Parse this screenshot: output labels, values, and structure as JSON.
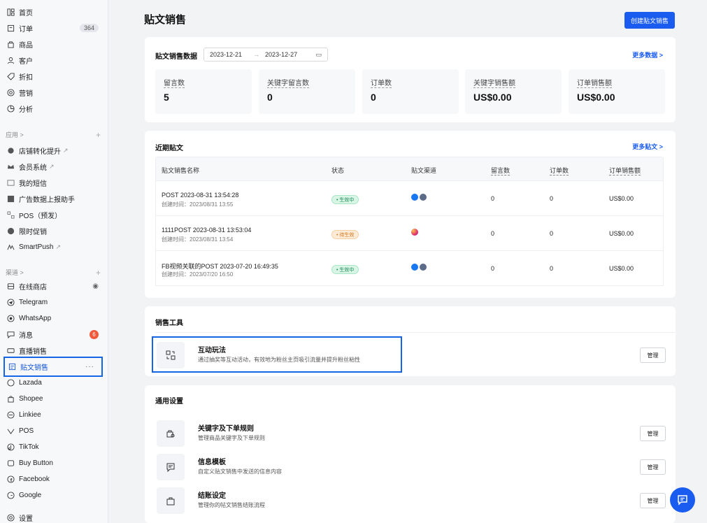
{
  "sidebar": {
    "main_items": [
      {
        "label": "首页"
      },
      {
        "label": "订单",
        "badge": "364"
      },
      {
        "label": "商品"
      },
      {
        "label": "客户"
      },
      {
        "label": "折扣"
      },
      {
        "label": "营销"
      },
      {
        "label": "分析"
      }
    ],
    "apps_section": "应用 >",
    "apps_items": [
      {
        "label": "店铺转化提升"
      },
      {
        "label": "会员系统"
      },
      {
        "label": "我的短信"
      },
      {
        "label": "广告数据上报助手"
      },
      {
        "label": "POS（预发）"
      },
      {
        "label": "限时促销"
      },
      {
        "label": "SmartPush"
      }
    ],
    "channels_section": "渠道 >",
    "channel_items": [
      {
        "label": "在线商店"
      },
      {
        "label": "Telegram"
      },
      {
        "label": "WhatsApp"
      },
      {
        "label": "消息",
        "badge": "6"
      },
      {
        "label": "直播销售"
      },
      {
        "label": "贴文销售"
      },
      {
        "label": "Lazada"
      },
      {
        "label": "Shopee"
      },
      {
        "label": "Linkiee"
      },
      {
        "label": "POS"
      },
      {
        "label": "TikTok"
      },
      {
        "label": "Buy Button"
      },
      {
        "label": "Facebook"
      },
      {
        "label": "Google"
      }
    ],
    "settings_label": "设置"
  },
  "header": {
    "title": "贴文销售",
    "create_button": "创建贴文销售"
  },
  "stats": {
    "title": "贴文销售数据",
    "date_start": "2023-12-21",
    "date_arrow": "→",
    "date_end": "2023-12-27",
    "more": "更多数据 >",
    "cards": [
      {
        "label": "留言数",
        "value": "5"
      },
      {
        "label": "关键字留言数",
        "value": "0"
      },
      {
        "label": "订单数",
        "value": "0"
      },
      {
        "label": "关键字销售额",
        "value": "US$0.00"
      },
      {
        "label": "订单销售额",
        "value": "US$0.00"
      }
    ]
  },
  "posts": {
    "title": "近期贴文",
    "more": "更多贴文 >",
    "columns": [
      "贴文销售名称",
      "状态",
      "贴文渠道",
      "留言数",
      "订单数",
      "订单销售额"
    ],
    "rows": [
      {
        "name": "POST 2023-08-31 13:54:28",
        "created": "创建时间：2023/08/31 13:55",
        "status": "• 生效中",
        "comments": "0",
        "orders": "0",
        "sales": "US$0.00"
      },
      {
        "name": "1111POST 2023-08-31 13:53:04",
        "created": "创建时间：2023/08/31 13:54",
        "status": "• 待生效",
        "comments": "0",
        "orders": "0",
        "sales": "US$0.00"
      },
      {
        "name": "FB视频关联的POST 2023-07-20 16:49:35",
        "created": "创建时间：2023/07/20 16:50",
        "status": "• 生效中",
        "comments": "0",
        "orders": "0",
        "sales": "US$0.00"
      }
    ]
  },
  "tools": {
    "title": "销售工具",
    "items": [
      {
        "name": "互动玩法",
        "desc": "通过抽奖等互动活动，有效地为粉丝主页吸引流量并提升粉丝粘性",
        "button": "管理"
      }
    ]
  },
  "general": {
    "title": "通用设置",
    "items": [
      {
        "name": "关键字及下单规则",
        "desc": "管理商品关键字及下单规则",
        "button": "管理"
      },
      {
        "name": "信息模板",
        "desc": "自定义贴文销售中发送的信息内容",
        "button": "管理"
      },
      {
        "name": "结账设定",
        "desc": "管理你的帖文销售结账流程",
        "button": "管理"
      }
    ]
  },
  "colors": {
    "accent": "#1a5cf0",
    "highlight": "#1565e6",
    "active_status": "#1c8a55",
    "pending_status": "#d4781d"
  }
}
